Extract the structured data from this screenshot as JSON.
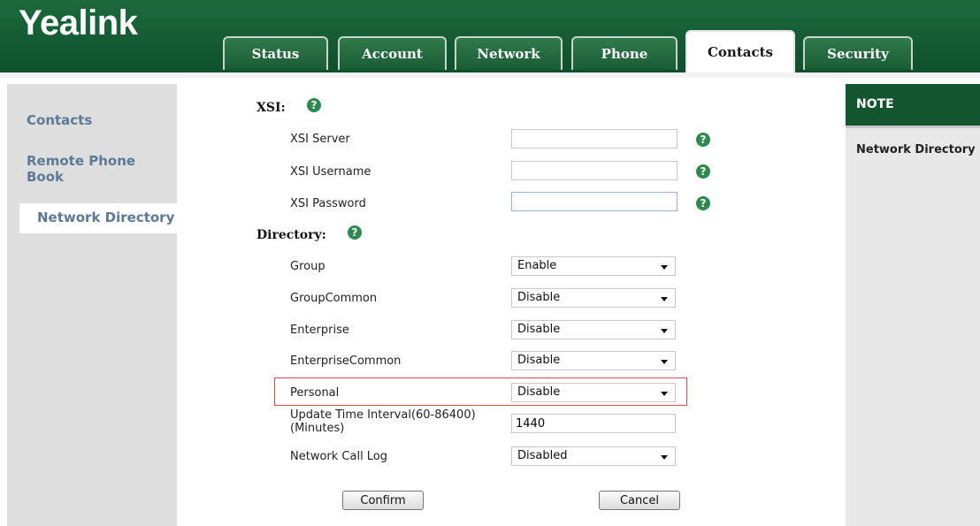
{
  "brand": {
    "logo_text": "Yealink"
  },
  "tabs": [
    {
      "label": "Status"
    },
    {
      "label": "Account"
    },
    {
      "label": "Network"
    },
    {
      "label": "Phone"
    },
    {
      "label": "Contacts",
      "active": true
    },
    {
      "label": "Security"
    }
  ],
  "sidebar": {
    "items": [
      {
        "label": "Contacts"
      },
      {
        "label": "Remote Phone Book"
      },
      {
        "label": "Network Directory",
        "active": true
      }
    ]
  },
  "note": {
    "title": "NOTE",
    "text": "Network Directory"
  },
  "xsi": {
    "section_label": "XSI:",
    "server_label": "XSI Server",
    "server_value": "",
    "username_label": "XSI Username",
    "username_value": "",
    "password_label": "XSI Password",
    "password_value": ""
  },
  "directory": {
    "section_label": "Directory:",
    "rows": [
      {
        "label": "Group",
        "value": "Enable"
      },
      {
        "label": "GroupCommon",
        "value": "Disable"
      },
      {
        "label": "Enterprise",
        "value": "Disable"
      },
      {
        "label": "EnterpriseCommon",
        "value": "Disable"
      },
      {
        "label": "Personal",
        "value": "Disable"
      }
    ],
    "update_interval_label_1": "Update Time Interval(60-86400)",
    "update_interval_label_2": "(Minutes)",
    "update_interval_value": "1440",
    "call_log_label": "Network Call Log",
    "call_log_value": "Disabled"
  },
  "buttons": {
    "confirm": "Confirm",
    "cancel": "Cancel"
  },
  "help_glyph": "?",
  "colors": {
    "header_green": "#1a5f36",
    "highlight_red": "#e04848",
    "nav_text": "#5b7a98"
  }
}
